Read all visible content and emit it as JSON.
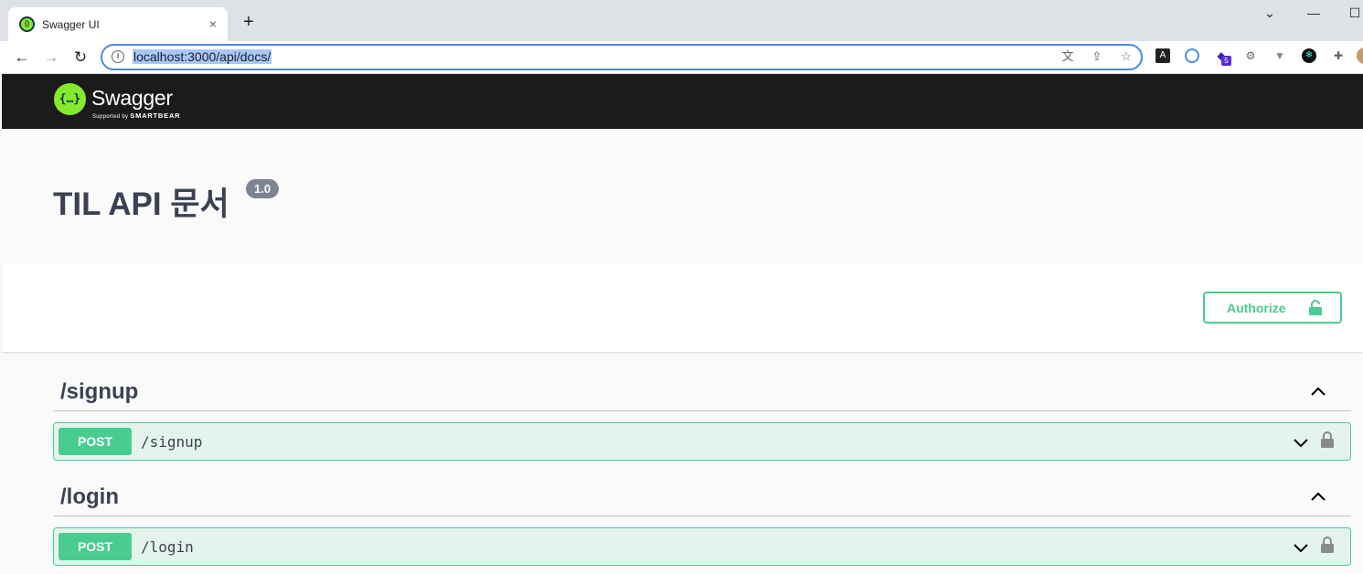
{
  "browser": {
    "tab_title": "Swagger UI",
    "tab_close": "×",
    "new_tab": "+",
    "url": "localhost:3000/api/docs/",
    "window_controls": [
      "⌄",
      "—",
      "☐"
    ]
  },
  "swagger": {
    "logo_text": "Swagger",
    "logo_mark": "{…}",
    "logo_sub_prefix": "Supported by",
    "logo_sub_brand": "SMARTBEAR",
    "title": "TIL API 문서",
    "version": "1.0",
    "authorize_label": "Authorize"
  },
  "groups": [
    {
      "name": "/signup",
      "operations": [
        {
          "method": "POST",
          "path": "/signup"
        }
      ]
    },
    {
      "name": "/login",
      "operations": [
        {
          "method": "POST",
          "path": "/login"
        }
      ]
    }
  ],
  "colors": {
    "post_accent": "#49cc90",
    "topbar": "#1b1b1b",
    "text": "#3b4151",
    "version_badge": "#7d8492"
  }
}
